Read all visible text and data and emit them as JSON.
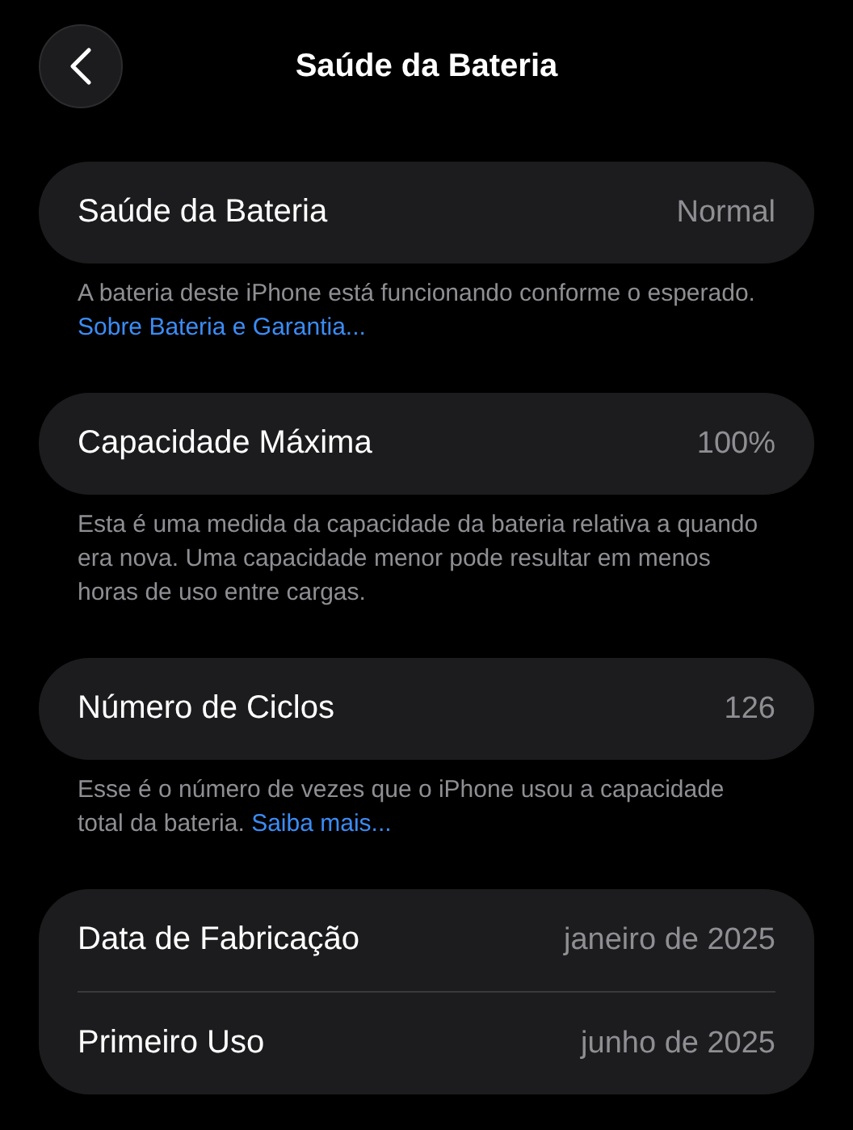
{
  "header": {
    "title": "Saúde da Bateria"
  },
  "sections": [
    {
      "rows": [
        {
          "label": "Saúde da Bateria",
          "value": "Normal"
        }
      ],
      "footer": {
        "text": "A bateria deste iPhone está funcionando conforme o esperado.",
        "link": "Sobre Bateria e Garantia..."
      }
    },
    {
      "rows": [
        {
          "label": "Capacidade Máxima",
          "value": "100%"
        }
      ],
      "footer": {
        "text": "Esta é uma medida da capacidade da bateria relativa a quando era nova. Uma capacidade menor pode resultar em menos horas de uso entre cargas."
      }
    },
    {
      "rows": [
        {
          "label": "Número de Ciclos",
          "value": "126"
        }
      ],
      "footer": {
        "text": "Esse é o número de vezes que o iPhone usou a capacidade total da bateria.",
        "link": "Saiba mais..."
      }
    },
    {
      "rows": [
        {
          "label": "Data de Fabricação",
          "value": "janeiro de 2025"
        },
        {
          "label": "Primeiro Uso",
          "value": "junho de 2025"
        }
      ]
    }
  ]
}
